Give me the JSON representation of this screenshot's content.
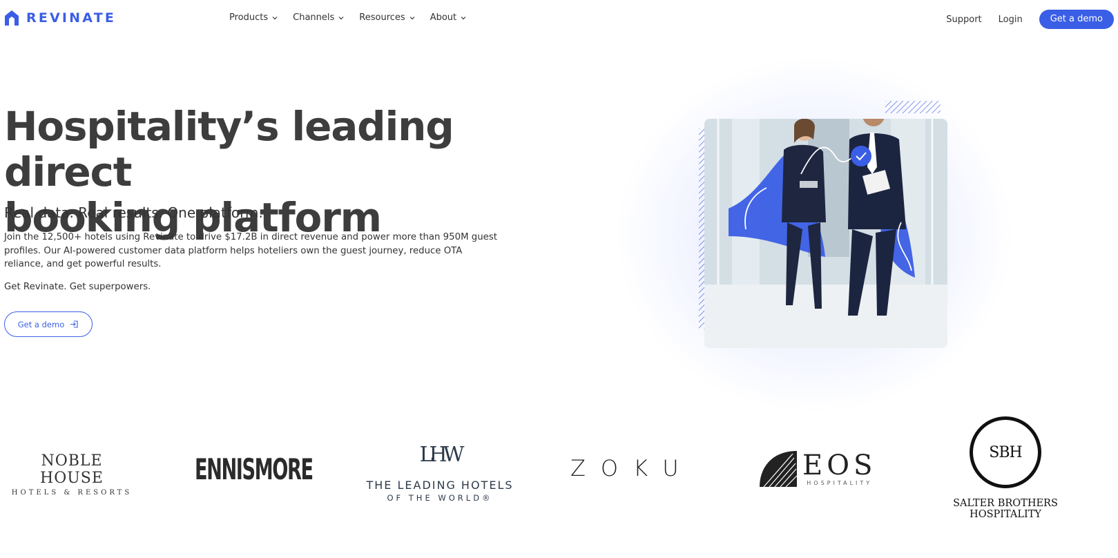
{
  "brand": {
    "name": "REVINATE",
    "color": "#3a5ee5"
  },
  "nav": {
    "menu": [
      {
        "label": "Products"
      },
      {
        "label": "Channels"
      },
      {
        "label": "Resources"
      },
      {
        "label": "About"
      }
    ],
    "support": "Support",
    "login": "Login",
    "cta": "Get a demo"
  },
  "hero": {
    "headline_line1": "Hospitality’s leading direct",
    "headline_line2": "booking platform",
    "subheadline": "Real data. Real results. One platform.",
    "body": "Join the 12,500+ hotels using Revinate to drive $17.2B in direct revenue and power more than 950M guest profiles. Our AI-powered customer data platform helps hoteliers own the guest journey, reduce OTA reliance, and get powerful results.",
    "tagline": "Get Revinate. Get superpowers.",
    "cta": "Get a demo",
    "image_icons": [
      "check-icon"
    ]
  },
  "clients": [
    {
      "name_line1": "NOBLE HOUSE",
      "name_line2": "HOTELS & RESORTS"
    },
    {
      "name_line1": "ENNISMORE"
    },
    {
      "monogram": "LHW",
      "name_line1": "THE LEADING HOTELS",
      "name_line2": "OF THE WORLD®"
    },
    {
      "name_line1": "ZOKU"
    },
    {
      "name_line1": "EOS",
      "name_line2": "HOSPITALITY"
    },
    {
      "monogram": "SBH",
      "name_line1": "SALTER BROTHERS",
      "name_line2": "HOSPITALITY"
    }
  ]
}
